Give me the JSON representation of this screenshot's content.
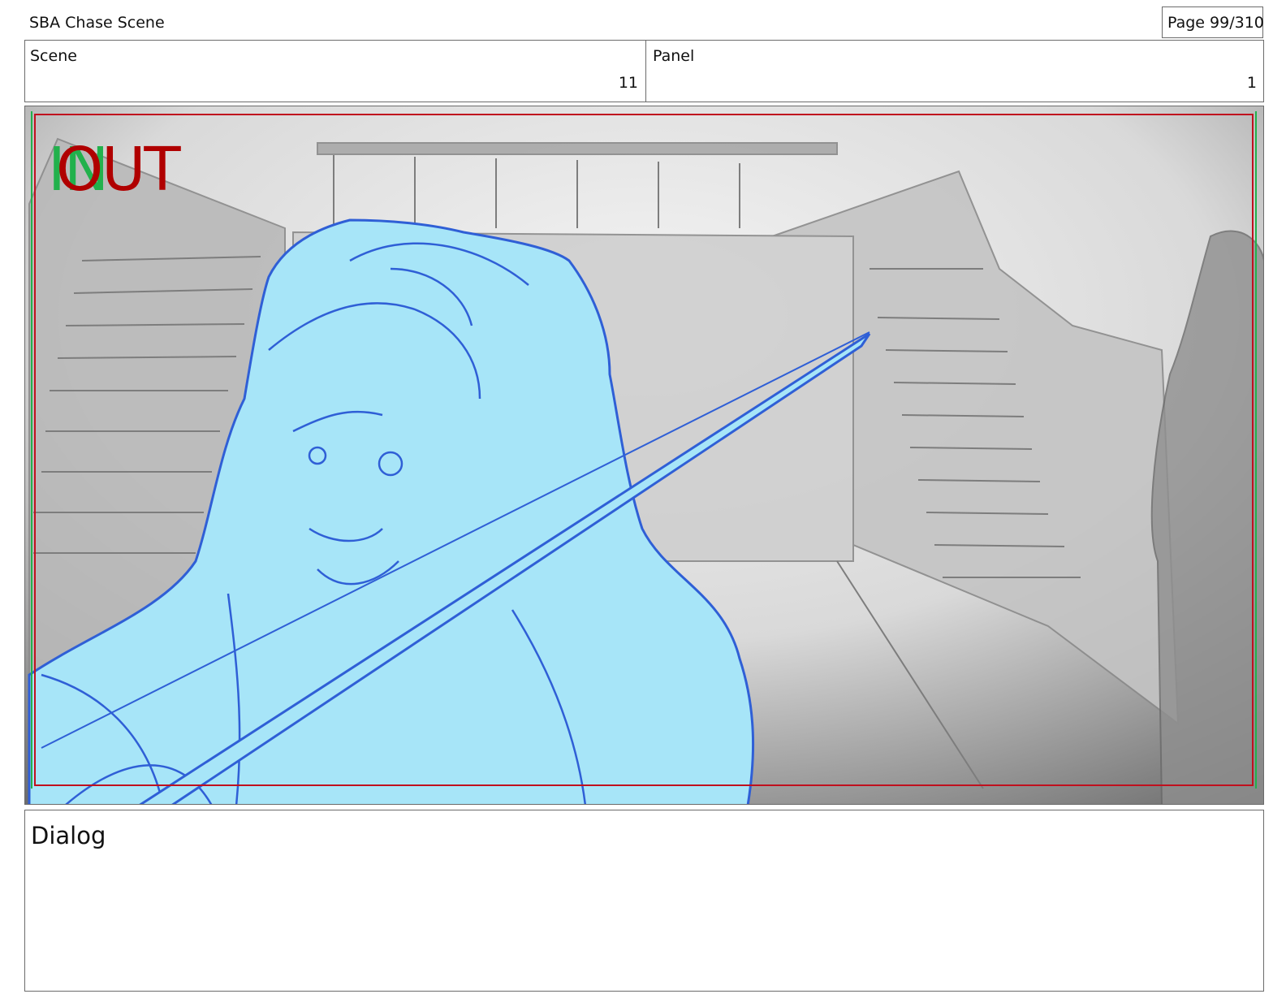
{
  "header": {
    "doc_title": "SBA Chase Scene",
    "page_label": "Page  99/310"
  },
  "info": {
    "scene_label": "Scene",
    "scene_value": "11",
    "panel_label": "Panel",
    "panel_value": "1"
  },
  "frame": {
    "in_label": "IN",
    "out_label": "OUT",
    "colors": {
      "in": "#22b14c",
      "out": "#b00000",
      "character_fill": "#a7e5f8",
      "character_line": "#2f5fd6",
      "background_gray": "#bdbdbd",
      "safe_frame": "#c0101e"
    }
  },
  "dialog": {
    "label": "Dialog"
  }
}
